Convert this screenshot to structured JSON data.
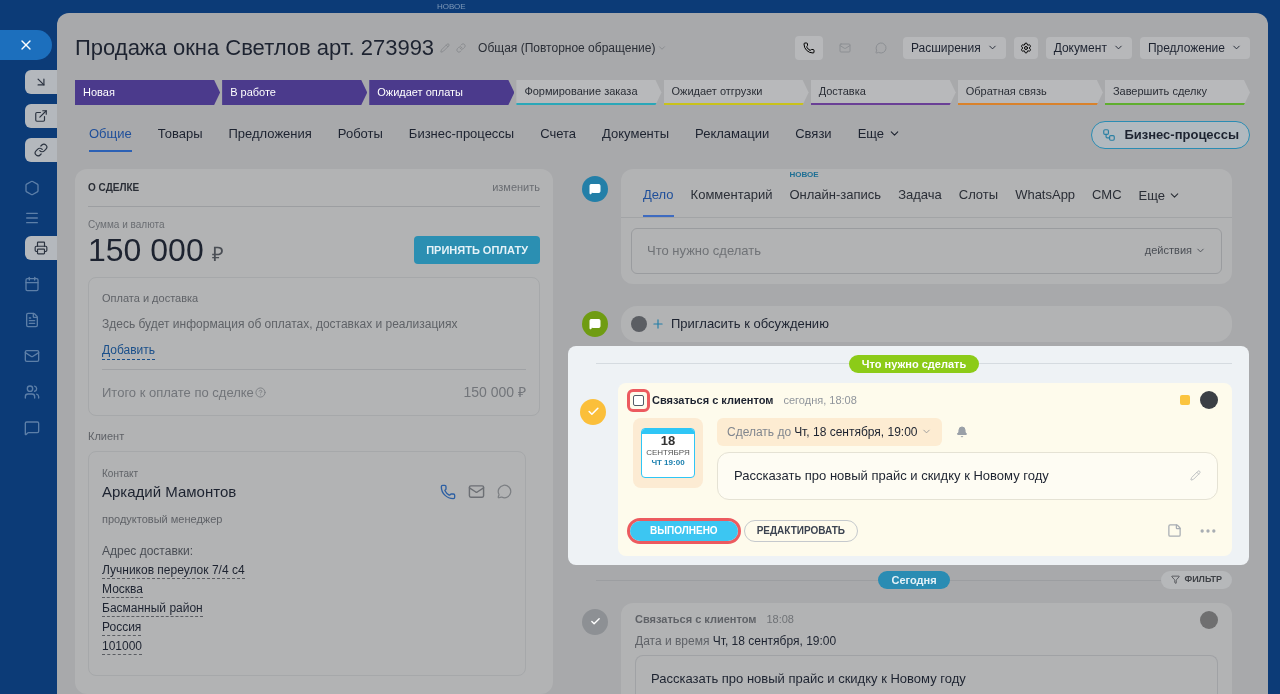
{
  "background_badge": "НОВОЕ",
  "header": {
    "title": "Продажа окна Светлов арт. 273993",
    "category": "Общая (Повторное обращение)",
    "buttons": [
      "Расширения",
      "Документ",
      "Предложение"
    ]
  },
  "stages": [
    {
      "label": "Новая",
      "passed": true,
      "color": "#4b3a8c"
    },
    {
      "label": "В работе",
      "passed": true,
      "color": "#4b3a8c"
    },
    {
      "label": "Ожидает оплаты",
      "passed": true,
      "color": "#4b3a8c"
    },
    {
      "label": "Формирование заказа",
      "passed": false,
      "color": "#2aa7b8"
    },
    {
      "label": "Ожидает отгрузки",
      "passed": false,
      "color": "#c9c21a"
    },
    {
      "label": "Доставка",
      "passed": false,
      "color": "#6a3f96"
    },
    {
      "label": "Обратная связь",
      "passed": false,
      "color": "#d9822b"
    },
    {
      "label": "Завершить сделку",
      "passed": false,
      "color": "#5fae2e"
    }
  ],
  "tabs": [
    {
      "label": "Общие",
      "selected": true
    },
    {
      "label": "Товары",
      "selected": false
    },
    {
      "label": "Предложения",
      "selected": false
    },
    {
      "label": "Роботы",
      "selected": false
    },
    {
      "label": "Бизнес-процессы",
      "selected": false
    },
    {
      "label": "Счета",
      "selected": false
    },
    {
      "label": "Документы",
      "selected": false
    },
    {
      "label": "Рекламации",
      "selected": false
    },
    {
      "label": "Связи",
      "selected": false
    }
  ],
  "tabs_more": "Еще",
  "process_button": "Бизнес-процессы",
  "deal": {
    "heading": "О СДЕЛКЕ",
    "edit": "изменить",
    "amount_label": "Сумма и валюта",
    "amount": "150 000",
    "currency": "₽",
    "pay_button": "ПРИНЯТЬ ОПЛАТУ",
    "payment": {
      "title": "Оплата и доставка",
      "info": "Здесь будет информация об оплатах, доставках и реализациях",
      "add_link": "Добавить",
      "total_label": "Итого к оплате по сделке",
      "total": "150 000 ₽"
    },
    "client_label": "Клиент",
    "contact": {
      "label": "Контакт",
      "name": "Аркадий Мамонтов",
      "position": "продуктовый менеджер",
      "address_label": "Адрес доставки:",
      "address": [
        "Лучников переулок 7/4 с4",
        "Москва",
        "Басманный район",
        "Россия",
        "101000"
      ]
    }
  },
  "composer": {
    "tabs": [
      {
        "label": "Дело",
        "selected": true
      },
      {
        "label": "Комментарий",
        "selected": false
      },
      {
        "label": "Онлайн-запись",
        "selected": false,
        "badge": "НОВОЕ"
      },
      {
        "label": "Задача",
        "selected": false
      },
      {
        "label": "Слоты",
        "selected": false
      },
      {
        "label": "WhatsApp",
        "selected": false
      },
      {
        "label": "СМС",
        "selected": false
      }
    ],
    "more": "Еще",
    "placeholder": "Что нужно сделать",
    "actions": "действия"
  },
  "invite": "Пригласить к обсуждению",
  "todo": {
    "label": "Что нужно сделать",
    "checked": false,
    "title": "Связаться с клиентом",
    "time": "сегодня, 18:08",
    "color": "#fbc43f",
    "calendar": {
      "day": "18",
      "month": "СЕНТЯБРЯ",
      "weekday_time": "ЧТ 19:00"
    },
    "deadline_label": "Сделать до",
    "deadline": "Чт, 18 сентября, 19:00",
    "note": "Рассказать про новый прайс и скидку к Новому году",
    "done_button": "ВЫПОЛНЕНО",
    "edit_button": "РЕДАКТИРОВАТЬ"
  },
  "today": "Сегодня",
  "filter": "ФИЛЬТР",
  "history": [
    {
      "title": "Связаться с клиентом",
      "time": "18:08",
      "date_label": "Дата и время",
      "date": "Чт, 18 сентября, 19:00",
      "note": "Рассказать про новый прайс и скидку к Новому году"
    }
  ]
}
